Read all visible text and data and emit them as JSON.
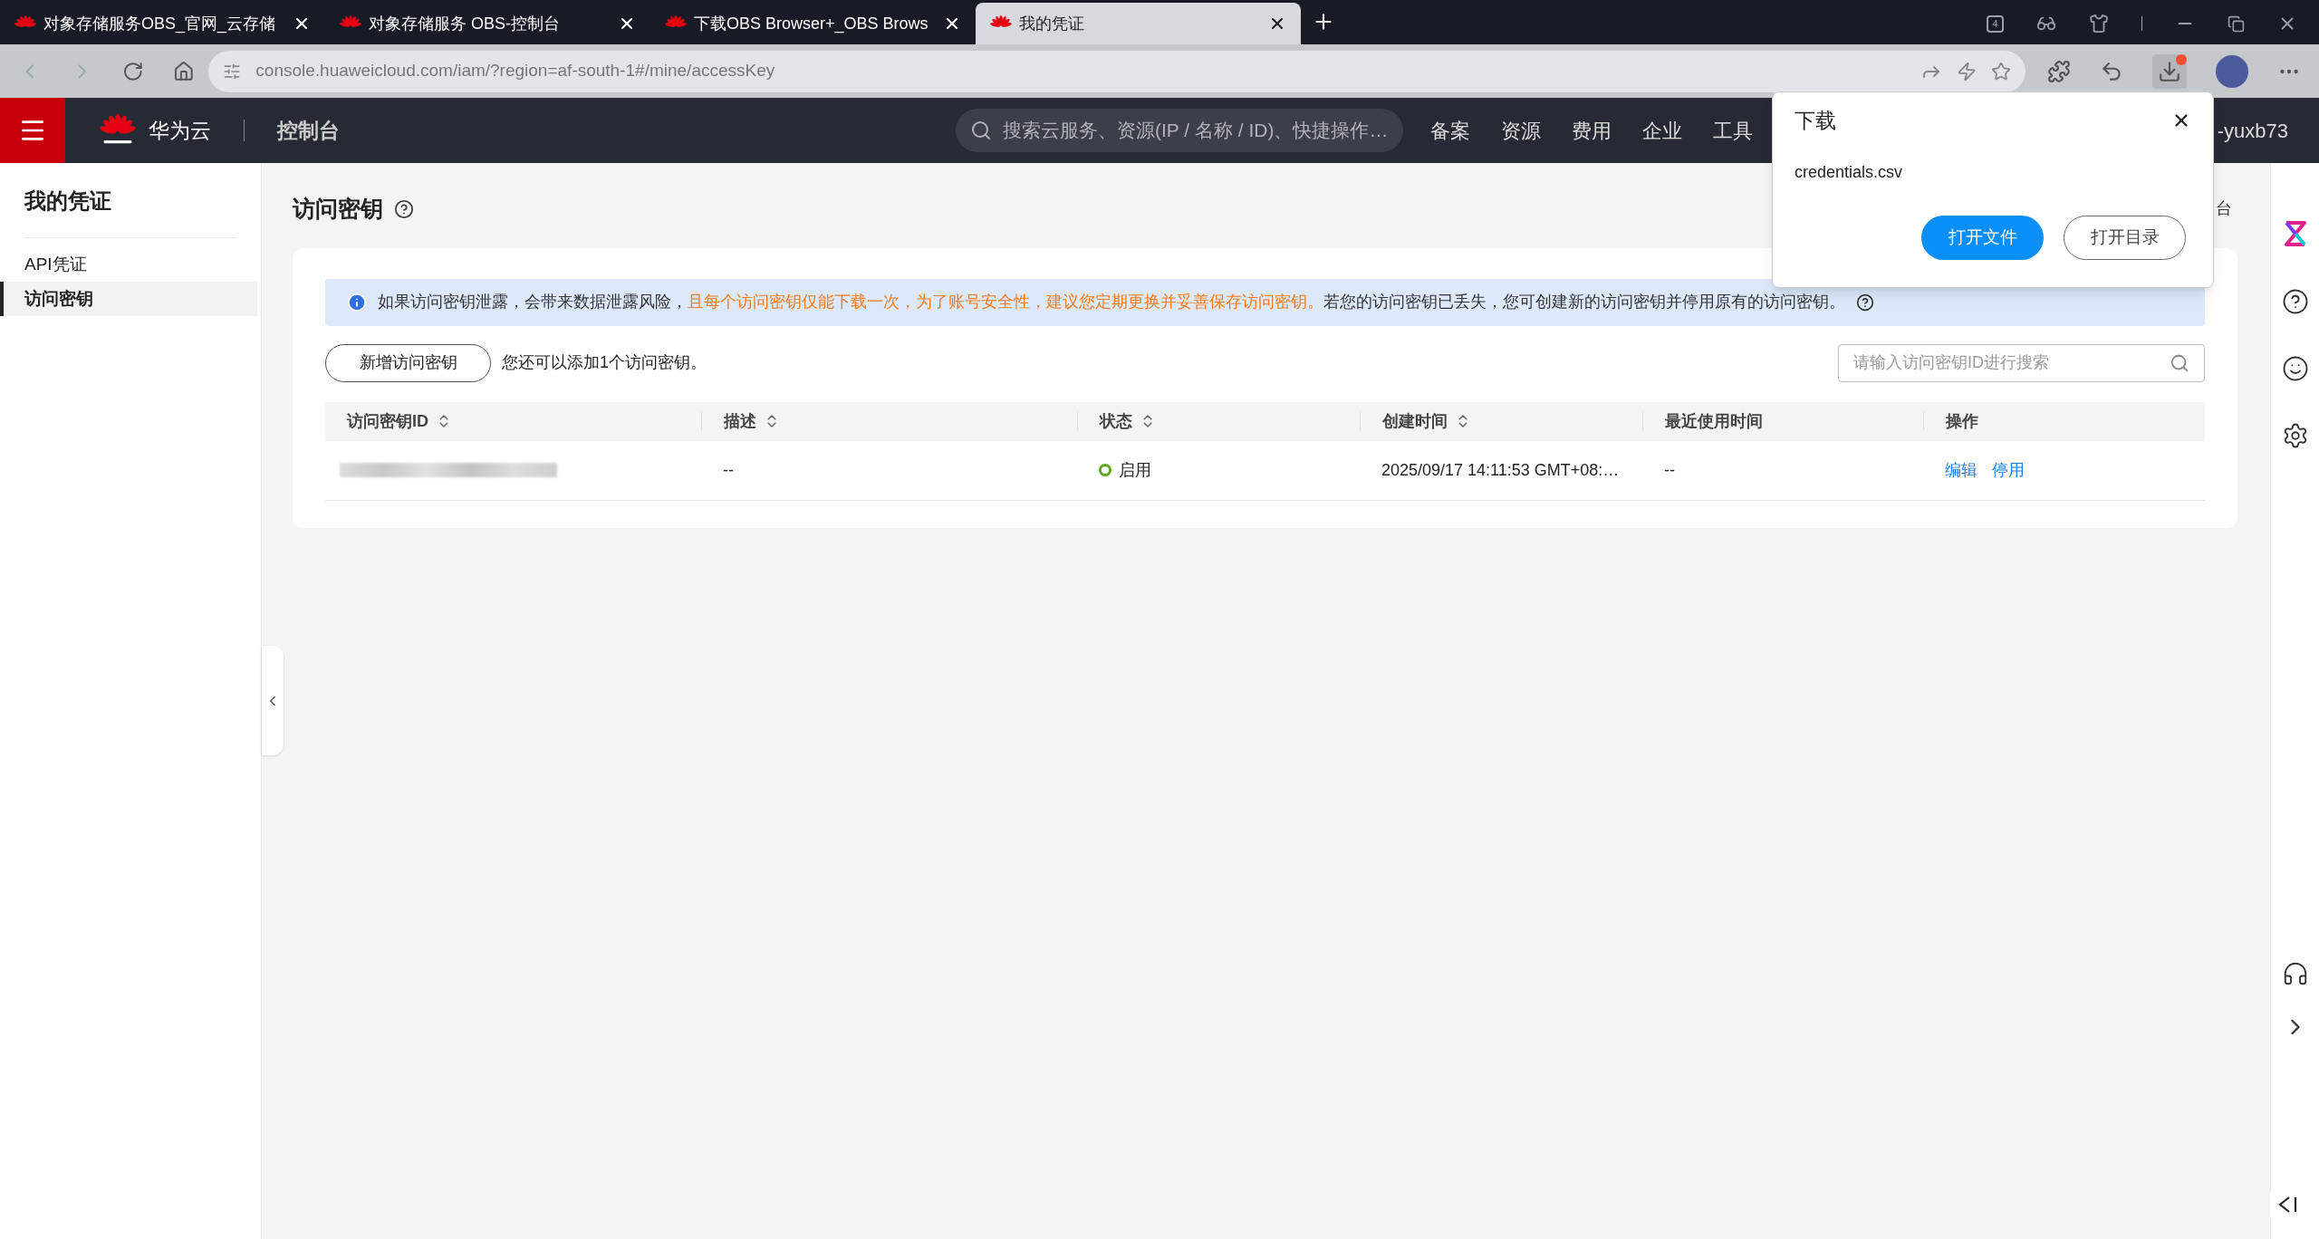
{
  "browser": {
    "tabs": [
      {
        "title": "对象存储服务OBS_官网_云存储",
        "selected": false
      },
      {
        "title": "对象存储服务 OBS-控制台",
        "selected": false
      },
      {
        "title": "下载OBS Browser+_OBS Brows",
        "selected": false
      },
      {
        "title": "我的凭证",
        "selected": true
      }
    ],
    "tab_count": "4",
    "url": "console.huaweicloud.com/iam/?region=af-south-1#/mine/accessKey"
  },
  "header": {
    "brand": "华为云",
    "console": "控制台",
    "search_placeholder": "搜索云服务、资源(IP / 名称 / ID)、快捷操作…",
    "nav": [
      "备案",
      "资源",
      "费用",
      "企业",
      "工具"
    ],
    "user": "-yuxb73"
  },
  "sidebar": {
    "title": "我的凭证",
    "items": [
      {
        "label": "API凭证",
        "selected": false
      },
      {
        "label": "访问密钥",
        "selected": true
      }
    ]
  },
  "page": {
    "title": "访问密钥",
    "breadcrumb_fragment": "台",
    "notice": [
      {
        "kind": "normal",
        "text": "如果访问密钥泄露，会带来数据泄露风险，"
      },
      {
        "kind": "warning",
        "text": "且每个访问密钥仅能下载一次，为了账号安全性，建议您定期更换并妥善保存访问密钥。"
      },
      {
        "kind": "normal",
        "text": "若您的访问密钥已丢失，您可创建新的访问密钥并停用原有的访问密钥。"
      }
    ],
    "add_button": "新增访问密钥",
    "quota_text": "您还可以添加1个访问密钥。",
    "search_placeholder": "请输入访问密钥ID进行搜索",
    "columns": [
      {
        "label": "访问密钥ID",
        "sortable": true
      },
      {
        "label": "描述",
        "sortable": true
      },
      {
        "label": "状态",
        "sortable": true
      },
      {
        "label": "创建时间",
        "sortable": true
      },
      {
        "label": "最近使用时间",
        "sortable": false
      },
      {
        "label": "操作",
        "sortable": false
      }
    ],
    "rows": [
      {
        "id_redacted": true,
        "description": "--",
        "status": "启用",
        "enabled": true,
        "created": "2025/09/17 14:11:53 GMT+08:…",
        "last_used": "--",
        "actions": [
          "编辑",
          "停用"
        ]
      }
    ]
  },
  "download_popup": {
    "title": "下载",
    "file": "credentials.csv",
    "buttons": [
      {
        "label": "打开文件",
        "primary": true
      },
      {
        "label": "打开目录",
        "primary": false
      }
    ]
  }
}
